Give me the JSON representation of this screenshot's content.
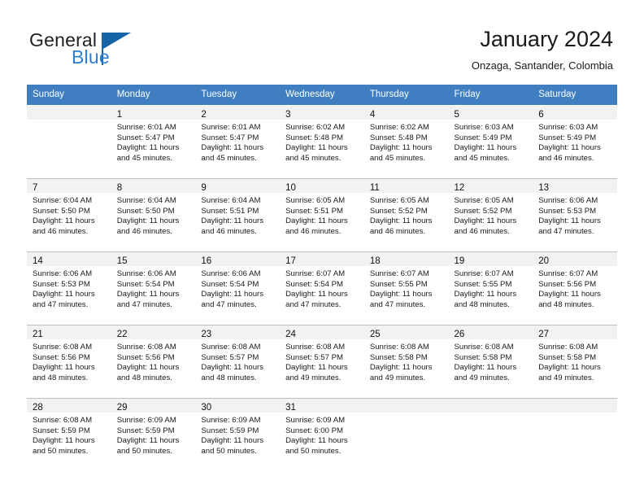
{
  "brand": {
    "name_part1": "General",
    "name_part2": "Blue",
    "accent_color": "#2a7fd4",
    "triangle_color": "#1763a8"
  },
  "header": {
    "title": "January 2024",
    "subtitle": "Onzaga, Santander, Colombia"
  },
  "calendar": {
    "header_background": "#3f7fc1",
    "daynum_background": "#f2f2f2",
    "weekday_headers": [
      "Sunday",
      "Monday",
      "Tuesday",
      "Wednesday",
      "Thursday",
      "Friday",
      "Saturday"
    ],
    "weeks": [
      [
        {
          "day": "",
          "sunrise": "",
          "sunset": "",
          "daylight1": "",
          "daylight2": ""
        },
        {
          "day": "1",
          "sunrise": "Sunrise: 6:01 AM",
          "sunset": "Sunset: 5:47 PM",
          "daylight1": "Daylight: 11 hours",
          "daylight2": "and 45 minutes."
        },
        {
          "day": "2",
          "sunrise": "Sunrise: 6:01 AM",
          "sunset": "Sunset: 5:47 PM",
          "daylight1": "Daylight: 11 hours",
          "daylight2": "and 45 minutes."
        },
        {
          "day": "3",
          "sunrise": "Sunrise: 6:02 AM",
          "sunset": "Sunset: 5:48 PM",
          "daylight1": "Daylight: 11 hours",
          "daylight2": "and 45 minutes."
        },
        {
          "day": "4",
          "sunrise": "Sunrise: 6:02 AM",
          "sunset": "Sunset: 5:48 PM",
          "daylight1": "Daylight: 11 hours",
          "daylight2": "and 45 minutes."
        },
        {
          "day": "5",
          "sunrise": "Sunrise: 6:03 AM",
          "sunset": "Sunset: 5:49 PM",
          "daylight1": "Daylight: 11 hours",
          "daylight2": "and 45 minutes."
        },
        {
          "day": "6",
          "sunrise": "Sunrise: 6:03 AM",
          "sunset": "Sunset: 5:49 PM",
          "daylight1": "Daylight: 11 hours",
          "daylight2": "and 46 minutes."
        }
      ],
      [
        {
          "day": "7",
          "sunrise": "Sunrise: 6:04 AM",
          "sunset": "Sunset: 5:50 PM",
          "daylight1": "Daylight: 11 hours",
          "daylight2": "and 46 minutes."
        },
        {
          "day": "8",
          "sunrise": "Sunrise: 6:04 AM",
          "sunset": "Sunset: 5:50 PM",
          "daylight1": "Daylight: 11 hours",
          "daylight2": "and 46 minutes."
        },
        {
          "day": "9",
          "sunrise": "Sunrise: 6:04 AM",
          "sunset": "Sunset: 5:51 PM",
          "daylight1": "Daylight: 11 hours",
          "daylight2": "and 46 minutes."
        },
        {
          "day": "10",
          "sunrise": "Sunrise: 6:05 AM",
          "sunset": "Sunset: 5:51 PM",
          "daylight1": "Daylight: 11 hours",
          "daylight2": "and 46 minutes."
        },
        {
          "day": "11",
          "sunrise": "Sunrise: 6:05 AM",
          "sunset": "Sunset: 5:52 PM",
          "daylight1": "Daylight: 11 hours",
          "daylight2": "and 46 minutes."
        },
        {
          "day": "12",
          "sunrise": "Sunrise: 6:05 AM",
          "sunset": "Sunset: 5:52 PM",
          "daylight1": "Daylight: 11 hours",
          "daylight2": "and 46 minutes."
        },
        {
          "day": "13",
          "sunrise": "Sunrise: 6:06 AM",
          "sunset": "Sunset: 5:53 PM",
          "daylight1": "Daylight: 11 hours",
          "daylight2": "and 47 minutes."
        }
      ],
      [
        {
          "day": "14",
          "sunrise": "Sunrise: 6:06 AM",
          "sunset": "Sunset: 5:53 PM",
          "daylight1": "Daylight: 11 hours",
          "daylight2": "and 47 minutes."
        },
        {
          "day": "15",
          "sunrise": "Sunrise: 6:06 AM",
          "sunset": "Sunset: 5:54 PM",
          "daylight1": "Daylight: 11 hours",
          "daylight2": "and 47 minutes."
        },
        {
          "day": "16",
          "sunrise": "Sunrise: 6:06 AM",
          "sunset": "Sunset: 5:54 PM",
          "daylight1": "Daylight: 11 hours",
          "daylight2": "and 47 minutes."
        },
        {
          "day": "17",
          "sunrise": "Sunrise: 6:07 AM",
          "sunset": "Sunset: 5:54 PM",
          "daylight1": "Daylight: 11 hours",
          "daylight2": "and 47 minutes."
        },
        {
          "day": "18",
          "sunrise": "Sunrise: 6:07 AM",
          "sunset": "Sunset: 5:55 PM",
          "daylight1": "Daylight: 11 hours",
          "daylight2": "and 47 minutes."
        },
        {
          "day": "19",
          "sunrise": "Sunrise: 6:07 AM",
          "sunset": "Sunset: 5:55 PM",
          "daylight1": "Daylight: 11 hours",
          "daylight2": "and 48 minutes."
        },
        {
          "day": "20",
          "sunrise": "Sunrise: 6:07 AM",
          "sunset": "Sunset: 5:56 PM",
          "daylight1": "Daylight: 11 hours",
          "daylight2": "and 48 minutes."
        }
      ],
      [
        {
          "day": "21",
          "sunrise": "Sunrise: 6:08 AM",
          "sunset": "Sunset: 5:56 PM",
          "daylight1": "Daylight: 11 hours",
          "daylight2": "and 48 minutes."
        },
        {
          "day": "22",
          "sunrise": "Sunrise: 6:08 AM",
          "sunset": "Sunset: 5:56 PM",
          "daylight1": "Daylight: 11 hours",
          "daylight2": "and 48 minutes."
        },
        {
          "day": "23",
          "sunrise": "Sunrise: 6:08 AM",
          "sunset": "Sunset: 5:57 PM",
          "daylight1": "Daylight: 11 hours",
          "daylight2": "and 48 minutes."
        },
        {
          "day": "24",
          "sunrise": "Sunrise: 6:08 AM",
          "sunset": "Sunset: 5:57 PM",
          "daylight1": "Daylight: 11 hours",
          "daylight2": "and 49 minutes."
        },
        {
          "day": "25",
          "sunrise": "Sunrise: 6:08 AM",
          "sunset": "Sunset: 5:58 PM",
          "daylight1": "Daylight: 11 hours",
          "daylight2": "and 49 minutes."
        },
        {
          "day": "26",
          "sunrise": "Sunrise: 6:08 AM",
          "sunset": "Sunset: 5:58 PM",
          "daylight1": "Daylight: 11 hours",
          "daylight2": "and 49 minutes."
        },
        {
          "day": "27",
          "sunrise": "Sunrise: 6:08 AM",
          "sunset": "Sunset: 5:58 PM",
          "daylight1": "Daylight: 11 hours",
          "daylight2": "and 49 minutes."
        }
      ],
      [
        {
          "day": "28",
          "sunrise": "Sunrise: 6:08 AM",
          "sunset": "Sunset: 5:59 PM",
          "daylight1": "Daylight: 11 hours",
          "daylight2": "and 50 minutes."
        },
        {
          "day": "29",
          "sunrise": "Sunrise: 6:09 AM",
          "sunset": "Sunset: 5:59 PM",
          "daylight1": "Daylight: 11 hours",
          "daylight2": "and 50 minutes."
        },
        {
          "day": "30",
          "sunrise": "Sunrise: 6:09 AM",
          "sunset": "Sunset: 5:59 PM",
          "daylight1": "Daylight: 11 hours",
          "daylight2": "and 50 minutes."
        },
        {
          "day": "31",
          "sunrise": "Sunrise: 6:09 AM",
          "sunset": "Sunset: 6:00 PM",
          "daylight1": "Daylight: 11 hours",
          "daylight2": "and 50 minutes."
        },
        {
          "day": "",
          "sunrise": "",
          "sunset": "",
          "daylight1": "",
          "daylight2": ""
        },
        {
          "day": "",
          "sunrise": "",
          "sunset": "",
          "daylight1": "",
          "daylight2": ""
        },
        {
          "day": "",
          "sunrise": "",
          "sunset": "",
          "daylight1": "",
          "daylight2": ""
        }
      ]
    ]
  }
}
